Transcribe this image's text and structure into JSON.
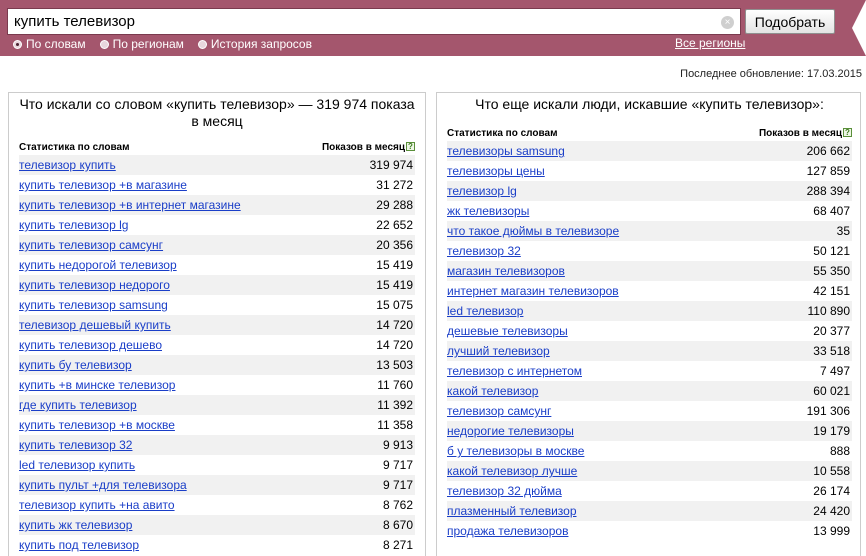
{
  "search": {
    "query": "купить телевизор",
    "submit_label": "Подобрать",
    "clear_symbol": "×",
    "modes": [
      {
        "label": "По словам",
        "selected": true
      },
      {
        "label": "По регионам",
        "selected": false
      },
      {
        "label": "История запросов",
        "selected": false
      }
    ],
    "regions_link": "Все регионы"
  },
  "last_updated": "Последнее обновление: 17.03.2015",
  "left_panel": {
    "title": "Что искали со словом «купить телевизор» — 319 974 показа в месяц",
    "col_phrase": "Статистика по словам",
    "col_count": "Показов в месяц",
    "help_symbol": "?",
    "rows": [
      {
        "phrase": "телевизор купить",
        "count": "319 974"
      },
      {
        "phrase": "купить телевизор +в магазине",
        "count": "31 272"
      },
      {
        "phrase": "купить телевизор +в интернет магазине",
        "count": "29 288"
      },
      {
        "phrase": "купить телевизор lg",
        "count": "22 652"
      },
      {
        "phrase": "купить телевизор самсунг",
        "count": "20 356"
      },
      {
        "phrase": "купить недорогой телевизор",
        "count": "15 419"
      },
      {
        "phrase": "купить телевизор недорого",
        "count": "15 419"
      },
      {
        "phrase": "купить телевизор samsung",
        "count": "15 075"
      },
      {
        "phrase": "телевизор дешевый купить",
        "count": "14 720"
      },
      {
        "phrase": "купить телевизор дешево",
        "count": "14 720"
      },
      {
        "phrase": "купить бу телевизор",
        "count": "13 503"
      },
      {
        "phrase": "купить +в минске телевизор",
        "count": "11 760"
      },
      {
        "phrase": "где купить телевизор",
        "count": "11 392"
      },
      {
        "phrase": "купить телевизор +в москве",
        "count": "11 358"
      },
      {
        "phrase": "купить телевизор 32",
        "count": "9 913"
      },
      {
        "phrase": "led телевизор купить",
        "count": "9 717"
      },
      {
        "phrase": "купить пульт +для телевизора",
        "count": "9 717"
      },
      {
        "phrase": "телевизор купить +на авито",
        "count": "8 762"
      },
      {
        "phrase": "купить жк телевизор",
        "count": "8 670"
      },
      {
        "phrase": "купить под телевизор",
        "count": "8 271"
      }
    ]
  },
  "right_panel": {
    "title": "Что еще искали люди, искавшие «купить телевизор»:",
    "col_phrase": "Статистика по словам",
    "col_count": "Показов в месяц",
    "help_symbol": "?",
    "rows": [
      {
        "phrase": "телевизоры samsung",
        "count": "206 662"
      },
      {
        "phrase": "телевизоры цены",
        "count": "127 859"
      },
      {
        "phrase": "телевизор lg",
        "count": "288 394"
      },
      {
        "phrase": "жк телевизоры",
        "count": "68 407"
      },
      {
        "phrase": "что такое дюймы в телевизоре",
        "count": "35"
      },
      {
        "phrase": "телевизор 32",
        "count": "50 121"
      },
      {
        "phrase": "магазин телевизоров",
        "count": "55 350"
      },
      {
        "phrase": "интернет магазин телевизоров",
        "count": "42 151"
      },
      {
        "phrase": "led телевизор",
        "count": "110 890"
      },
      {
        "phrase": "дешевые телевизоры",
        "count": "20 377"
      },
      {
        "phrase": "лучший телевизор",
        "count": "33 518"
      },
      {
        "phrase": "телевизор с интернетом",
        "count": "7 497"
      },
      {
        "phrase": "какой телевизор",
        "count": "60 021"
      },
      {
        "phrase": "телевизор самсунг",
        "count": "191 306"
      },
      {
        "phrase": "недорогие телевизоры",
        "count": "19 179"
      },
      {
        "phrase": "б у телевизоры в москве",
        "count": "888"
      },
      {
        "phrase": "какой телевизор лучше",
        "count": "10 558"
      },
      {
        "phrase": "телевизор 32 дюйма",
        "count": "26 174"
      },
      {
        "phrase": "плазменный телевизор",
        "count": "24 420"
      },
      {
        "phrase": "продажа телевизоров",
        "count": "13 999"
      }
    ]
  }
}
